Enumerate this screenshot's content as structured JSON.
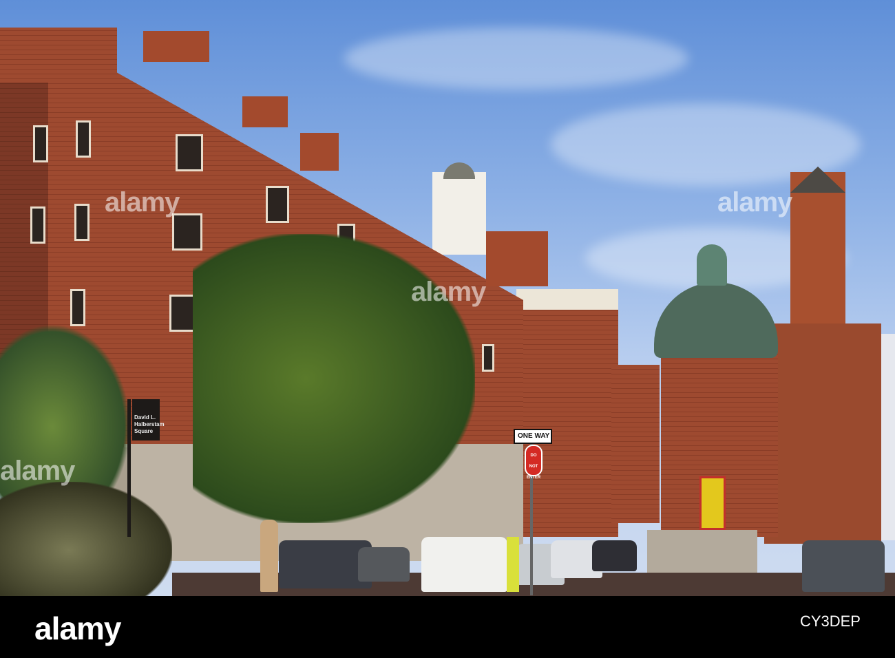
{
  "photo": {
    "signs": {
      "street_sign": "David L. Halberstam Square",
      "one_way": "ONE WAY",
      "do_not_enter_top": "DO NOT",
      "do_not_enter_bottom": "ENTER"
    },
    "watermarks": [
      "alamy",
      "alamy",
      "alamy",
      "alamy"
    ]
  },
  "footer": {
    "logo": "alamy",
    "image_id": "CY3DEP"
  },
  "colors": {
    "sky": "#8fb2e6",
    "brick": "#9e4a30",
    "footer": "#000000"
  }
}
